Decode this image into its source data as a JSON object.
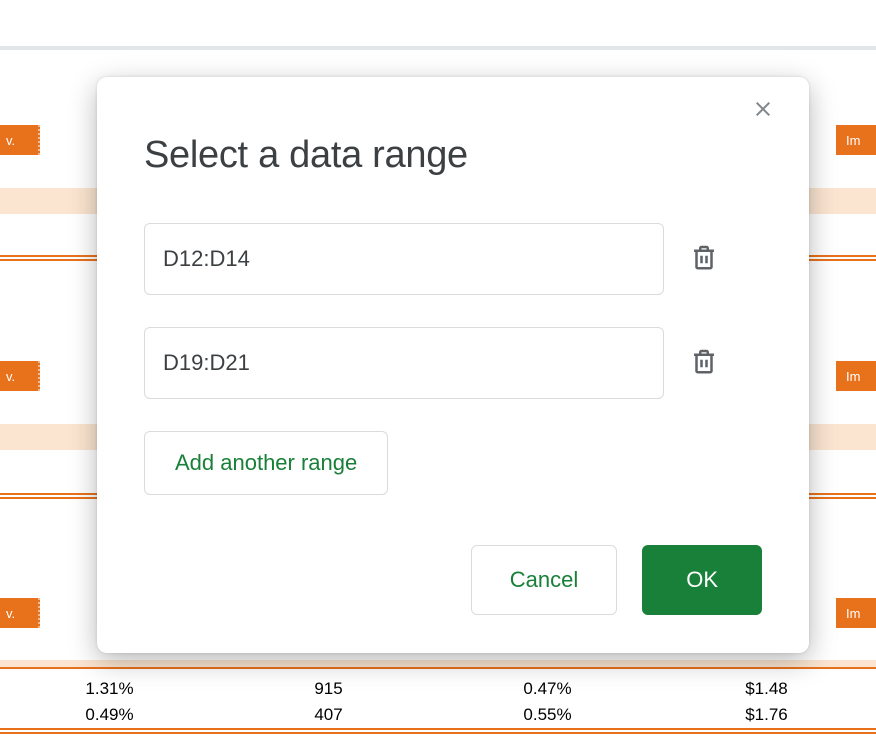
{
  "dialog": {
    "title": "Select a data range",
    "ranges": [
      {
        "value": "D12:D14"
      },
      {
        "value": "D19:D21"
      }
    ],
    "add_range_label": "Add another range",
    "cancel_label": "Cancel",
    "ok_label": "OK"
  },
  "background": {
    "header_left_text": "v.",
    "header_right_text": "Im",
    "rows": [
      [
        "1.31%",
        "915",
        "0.47%",
        "$1.48"
      ],
      [
        "0.49%",
        "407",
        "0.55%",
        "$1.76"
      ]
    ]
  }
}
